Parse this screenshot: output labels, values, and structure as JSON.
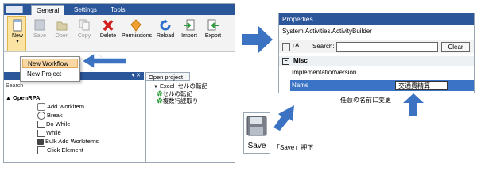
{
  "tabs": [
    "General",
    "Settings",
    "Tools"
  ],
  "ribbon": {
    "new": "New",
    "save": "Save",
    "open": "Open",
    "copy": "Copy",
    "delete": "Delete",
    "permissions": "Permissions",
    "reload": "Reload",
    "import": "Import",
    "export": "Export"
  },
  "new_menu": {
    "new_workflow": "New Workflow",
    "new_project": "New Project",
    "faded_suffix": "iles"
  },
  "toolbox": {
    "search_label": "Search",
    "items": [
      "OpenRPA",
      "Add Workitem",
      "Break",
      "Do While",
      "While",
      "Bulk Add Workitems",
      "Click Element"
    ]
  },
  "open_project": {
    "tab": "Open project",
    "project": "Excel_セルの転記",
    "files": [
      "セルの転記",
      "複数行読取り"
    ]
  },
  "properties": {
    "title": "Properties",
    "class_name": "System.Activities.ActivityBuilder",
    "search_label": "Search:",
    "clear_label": "Clear",
    "category": "Misc",
    "rows": [
      {
        "name": "ImplementationVersion",
        "value": ""
      },
      {
        "name": "Name",
        "value": "交通費精算"
      }
    ]
  },
  "annotations": {
    "rename_hint": "任意の名前に変更",
    "save_hint": "「Save」押下"
  },
  "save_button": {
    "label": "Save"
  },
  "colors": {
    "titlebar": "#2b579a",
    "arrow": "#3b73c2",
    "highlight_row": "#3b74c6",
    "menu_highlight": "#f8d7a4"
  }
}
